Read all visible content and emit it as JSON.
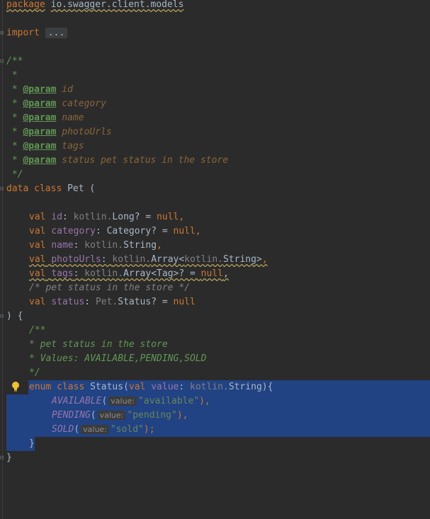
{
  "editor": {
    "package": {
      "kw": "package",
      "name": "io.swagger.client.models"
    },
    "import": {
      "kw": "import",
      "fold": "..."
    },
    "doc": {
      "open": "/**",
      "star": " *",
      "params": [
        {
          "star": " * ",
          "tag": "@param",
          "name": "id",
          "rest": ""
        },
        {
          "star": " * ",
          "tag": "@param",
          "name": "category",
          "rest": ""
        },
        {
          "star": " * ",
          "tag": "@param",
          "name": "name",
          "rest": ""
        },
        {
          "star": " * ",
          "tag": "@param",
          "name": "photoUrls",
          "rest": ""
        },
        {
          "star": " * ",
          "tag": "@param",
          "name": "tags",
          "rest": ""
        },
        {
          "star": " * ",
          "tag": "@param",
          "name": "status",
          "rest": " pet status in the store"
        }
      ],
      "close": " */"
    },
    "class_decl": {
      "kw": "data class",
      "name": " Pet ("
    },
    "fields": [
      {
        "kw": "val",
        "name": "id",
        "type": [
          {
            "c": "ty",
            "t": "kotlin."
          },
          {
            "c": "",
            "t": "Long? = "
          },
          {
            "c": "kw",
            "t": "null"
          },
          {
            "c": "",
            "t": ","
          }
        ]
      },
      {
        "kw": "val",
        "name": "category",
        "type": [
          {
            "c": "",
            "t": "Category? = "
          },
          {
            "c": "kw",
            "t": "null"
          },
          {
            "c": "",
            "t": ","
          }
        ]
      },
      {
        "kw": "val",
        "name": "name",
        "type": [
          {
            "c": "ty",
            "t": "kotlin."
          },
          {
            "c": "",
            "t": "String"
          },
          {
            "c": "kw",
            "t": ","
          }
        ]
      },
      {
        "kw": "val",
        "name": "photoUrls",
        "type": [
          {
            "c": "ty",
            "t": "kotlin."
          },
          {
            "c": "",
            "t": "Array<"
          },
          {
            "c": "ty",
            "t": "kotlin."
          },
          {
            "c": "",
            "t": "String>"
          },
          {
            "c": "kw",
            "t": ","
          }
        ]
      },
      {
        "kw": "val",
        "name": "tags",
        "type": [
          {
            "c": "ty",
            "t": "kotlin."
          },
          {
            "c": "",
            "t": "Array<Tag>? = "
          },
          {
            "c": "kw",
            "t": "null"
          },
          {
            "c": "",
            "t": ","
          }
        ]
      }
    ],
    "block_comment": "/* pet status in the store */",
    "status_field": {
      "kw": "val",
      "name": "status",
      "type_prefix": "Pet.",
      "type_rest": "Status? = ",
      "null": "null"
    },
    "close_paren": ") {",
    "enum_doc": {
      "open": "/**",
      "l1": "* pet status in the store",
      "l2": "* Values: AVAILABLE,PENDING,SOLD",
      "close": "*/"
    },
    "enum_decl": {
      "kw": "enum class",
      "name": " Status(",
      "val": "val",
      "param": "value",
      "type_prefix": "kotlin.",
      "type_rest": "String){"
    },
    "enum_values": [
      {
        "name": "AVAILABLE",
        "hint": "value:",
        "str": "\"available\"",
        "end": "),"
      },
      {
        "name": "PENDING",
        "hint": "value:",
        "str": "\"pending\"",
        "end": "),"
      },
      {
        "name": "SOLD",
        "hint": "value:",
        "str": "\"sold\"",
        "end": ");"
      }
    ],
    "enum_close": "}",
    "class_close": "}"
  },
  "colors": {
    "background": "#2b2b2b",
    "selection": "#214283",
    "keyword": "#cc7832",
    "string": "#6a8759",
    "comment": "#629755"
  },
  "icons": {
    "bulb": "lightbulb-icon"
  }
}
